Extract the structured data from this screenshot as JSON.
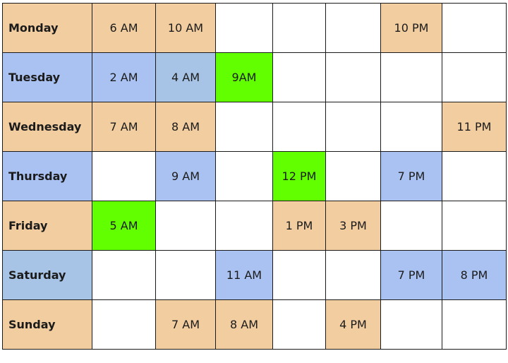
{
  "colors": {
    "tan": "#f2cda0",
    "blue": "#a9c2f2",
    "steel": "#a7c4e6",
    "green": "#62ff00",
    "empty": "#ffffff",
    "border": "#1a1a1a"
  },
  "rows": [
    {
      "day": "Monday",
      "day_color": "tan",
      "cells": [
        {
          "text": "6 AM",
          "color": "tan"
        },
        {
          "text": "10 AM",
          "color": "tan"
        },
        {
          "text": "",
          "color": "empty"
        },
        {
          "text": "",
          "color": "empty"
        },
        {
          "text": "",
          "color": "empty"
        },
        {
          "text": "10 PM",
          "color": "tan"
        },
        {
          "text": "",
          "color": "empty"
        }
      ]
    },
    {
      "day": "Tuesday",
      "day_color": "blue",
      "cells": [
        {
          "text": "2 AM",
          "color": "blue"
        },
        {
          "text": "4 AM",
          "color": "steel"
        },
        {
          "text": "9AM",
          "color": "green"
        },
        {
          "text": "",
          "color": "empty"
        },
        {
          "text": "",
          "color": "empty"
        },
        {
          "text": "",
          "color": "empty"
        },
        {
          "text": "",
          "color": "empty"
        }
      ]
    },
    {
      "day": "Wednesday",
      "day_color": "tan",
      "cells": [
        {
          "text": "7 AM",
          "color": "tan"
        },
        {
          "text": "8 AM",
          "color": "tan"
        },
        {
          "text": "",
          "color": "empty"
        },
        {
          "text": "",
          "color": "empty"
        },
        {
          "text": "",
          "color": "empty"
        },
        {
          "text": "",
          "color": "empty"
        },
        {
          "text": "11 PM",
          "color": "tan"
        }
      ]
    },
    {
      "day": "Thursday",
      "day_color": "blue",
      "cells": [
        {
          "text": "",
          "color": "empty"
        },
        {
          "text": "9 AM",
          "color": "blue"
        },
        {
          "text": "",
          "color": "empty"
        },
        {
          "text": "12 PM",
          "color": "green"
        },
        {
          "text": "",
          "color": "empty"
        },
        {
          "text": "7 PM",
          "color": "blue"
        },
        {
          "text": "",
          "color": "empty"
        }
      ]
    },
    {
      "day": "Friday",
      "day_color": "tan",
      "cells": [
        {
          "text": "5 AM",
          "color": "green"
        },
        {
          "text": "",
          "color": "empty"
        },
        {
          "text": "",
          "color": "empty"
        },
        {
          "text": "1 PM",
          "color": "tan"
        },
        {
          "text": "3 PM",
          "color": "tan"
        },
        {
          "text": "",
          "color": "empty"
        },
        {
          "text": "",
          "color": "empty"
        }
      ]
    },
    {
      "day": "Saturday",
      "day_color": "steel",
      "cells": [
        {
          "text": "",
          "color": "empty"
        },
        {
          "text": "",
          "color": "empty"
        },
        {
          "text": "11 AM",
          "color": "blue"
        },
        {
          "text": "",
          "color": "empty"
        },
        {
          "text": "",
          "color": "empty"
        },
        {
          "text": "7 PM",
          "color": "blue"
        },
        {
          "text": "8 PM",
          "color": "blue"
        }
      ]
    },
    {
      "day": "Sunday",
      "day_color": "tan",
      "cells": [
        {
          "text": "",
          "color": "empty"
        },
        {
          "text": "7 AM",
          "color": "tan"
        },
        {
          "text": "8 AM",
          "color": "tan"
        },
        {
          "text": "",
          "color": "empty"
        },
        {
          "text": "4 PM",
          "color": "tan"
        },
        {
          "text": "",
          "color": "empty"
        },
        {
          "text": "",
          "color": "empty"
        }
      ]
    }
  ]
}
